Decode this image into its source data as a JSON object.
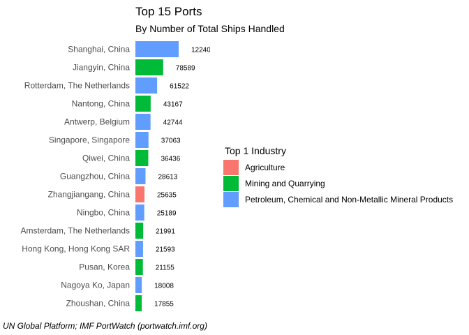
{
  "chart_data": {
    "type": "bar",
    "orientation": "horizontal",
    "title": "Top 15 Ports",
    "subtitle": "By Number of Total Ships Handled",
    "caption": "UN Global Platform; IMF PortWatch (portwatch.imf.org)",
    "legend": {
      "title": "Top 1 Industry",
      "placement": "right",
      "items": [
        {
          "label": "Agriculture",
          "color": "#F8766D"
        },
        {
          "label": "Mining and Quarrying",
          "color": "#00BA38"
        },
        {
          "label": "Petroleum, Chemical and Non-Metallic Mineral Products",
          "color": "#619CFF"
        }
      ]
    },
    "grid": false,
    "categories": [
      "Shanghai, China",
      "Jiangyin, China",
      "Rotterdam, The Netherlands",
      "Nantong, China",
      "Antwerp, Belgium",
      "Singapore, Singapore",
      "Qiwei, China",
      "Guangzhou, China",
      "Zhangjiangang, China",
      "Ningbo, China",
      "Amsterdam, The Netherlands",
      "Hong Kong, Hong Kong SAR",
      "Pusan, Korea",
      "Nagoya Ko, Japan",
      "Zhoushan, China"
    ],
    "values": [
      122400,
      78589,
      61522,
      43167,
      42744,
      37063,
      36436,
      28613,
      25635,
      25189,
      21991,
      21593,
      21155,
      18008,
      17855
    ],
    "value_labels": [
      "12240",
      "78589",
      "61522",
      "43167",
      "42744",
      "37063",
      "36436",
      "28613",
      "25635",
      "25189",
      "21991",
      "21593",
      "21155",
      "18008",
      "17855"
    ],
    "industry": [
      "Petroleum, Chemical and Non-Metallic Mineral Products",
      "Mining and Quarrying",
      "Petroleum, Chemical and Non-Metallic Mineral Products",
      "Mining and Quarrying",
      "Petroleum, Chemical and Non-Metallic Mineral Products",
      "Petroleum, Chemical and Non-Metallic Mineral Products",
      "Mining and Quarrying",
      "Petroleum, Chemical and Non-Metallic Mineral Products",
      "Agriculture",
      "Petroleum, Chemical and Non-Metallic Mineral Products",
      "Mining and Quarrying",
      "Petroleum, Chemical and Non-Metallic Mineral Products",
      "Mining and Quarrying",
      "Petroleum, Chemical and Non-Metallic Mineral Products",
      "Mining and Quarrying"
    ]
  }
}
